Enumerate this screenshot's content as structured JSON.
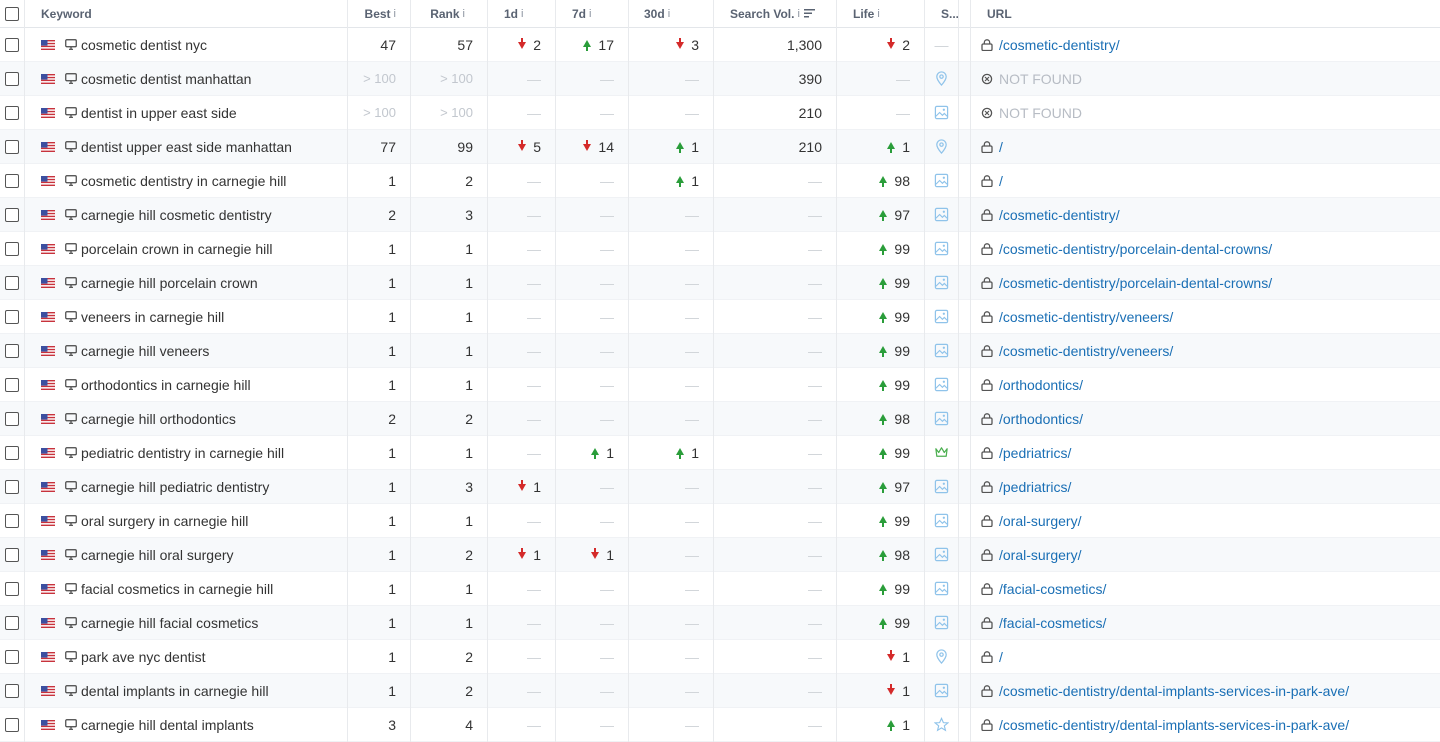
{
  "header": {
    "keyword": "Keyword",
    "best": "Best",
    "rank": "Rank",
    "d1": "1d",
    "d7": "7d",
    "d30": "30d",
    "search_vol": "Search Vol.",
    "life": "Life",
    "serp": "S...",
    "url": "URL",
    "info": "i"
  },
  "colors": {
    "up": "#2a9d3a",
    "down": "#d42a2a",
    "link": "#1a6fb5",
    "muted": "#c2c7ce"
  },
  "rows": [
    {
      "kw": "cosmetic dentist nyc",
      "best": "47",
      "rank": "57",
      "d1": {
        "dir": "down",
        "v": "2"
      },
      "d7": {
        "dir": "up",
        "v": "17"
      },
      "d30": {
        "dir": "down",
        "v": "3"
      },
      "vol": "1,300",
      "life": {
        "dir": "down",
        "v": "2"
      },
      "serp": "none",
      "url": "/cosmetic-dentistry/"
    },
    {
      "kw": "cosmetic dentist manhattan",
      "best": "> 100",
      "rank": "> 100",
      "d1": null,
      "d7": null,
      "d30": null,
      "vol": "390",
      "life": null,
      "serp": "pin-icon",
      "url": "NOT FOUND",
      "notfound": true
    },
    {
      "kw": "dentist in upper east side",
      "best": "> 100",
      "rank": "> 100",
      "d1": null,
      "d7": null,
      "d30": null,
      "vol": "210",
      "life": null,
      "serp": "image-icon",
      "url": "NOT FOUND",
      "notfound": true
    },
    {
      "kw": "dentist upper east side manhattan",
      "best": "77",
      "rank": "99",
      "d1": {
        "dir": "down",
        "v": "5"
      },
      "d7": {
        "dir": "down",
        "v": "14"
      },
      "d30": {
        "dir": "up",
        "v": "1"
      },
      "vol": "210",
      "life": {
        "dir": "up",
        "v": "1"
      },
      "serp": "pin-icon",
      "url": "/"
    },
    {
      "kw": "cosmetic dentistry in carnegie hill",
      "best": "1",
      "rank": "2",
      "d1": null,
      "d7": null,
      "d30": {
        "dir": "up",
        "v": "1"
      },
      "vol": null,
      "life": {
        "dir": "up",
        "v": "98"
      },
      "serp": "image-icon",
      "url": "/"
    },
    {
      "kw": "carnegie hill cosmetic dentistry",
      "best": "2",
      "rank": "3",
      "d1": null,
      "d7": null,
      "d30": null,
      "vol": null,
      "life": {
        "dir": "up",
        "v": "97"
      },
      "serp": "image-icon",
      "url": "/cosmetic-dentistry/"
    },
    {
      "kw": "porcelain crown in carnegie hill",
      "best": "1",
      "rank": "1",
      "d1": null,
      "d7": null,
      "d30": null,
      "vol": null,
      "life": {
        "dir": "up",
        "v": "99"
      },
      "serp": "image-icon",
      "url": "/cosmetic-dentistry/porcelain-dental-crowns/"
    },
    {
      "kw": "carnegie hill porcelain crown",
      "best": "1",
      "rank": "1",
      "d1": null,
      "d7": null,
      "d30": null,
      "vol": null,
      "life": {
        "dir": "up",
        "v": "99"
      },
      "serp": "image-icon",
      "url": "/cosmetic-dentistry/porcelain-dental-crowns/"
    },
    {
      "kw": "veneers in carnegie hill",
      "best": "1",
      "rank": "1",
      "d1": null,
      "d7": null,
      "d30": null,
      "vol": null,
      "life": {
        "dir": "up",
        "v": "99"
      },
      "serp": "image-icon",
      "url": "/cosmetic-dentistry/veneers/"
    },
    {
      "kw": "carnegie hill veneers",
      "best": "1",
      "rank": "1",
      "d1": null,
      "d7": null,
      "d30": null,
      "vol": null,
      "life": {
        "dir": "up",
        "v": "99"
      },
      "serp": "image-icon",
      "url": "/cosmetic-dentistry/veneers/"
    },
    {
      "kw": "orthodontics in carnegie hill",
      "best": "1",
      "rank": "1",
      "d1": null,
      "d7": null,
      "d30": null,
      "vol": null,
      "life": {
        "dir": "up",
        "v": "99"
      },
      "serp": "image-icon",
      "url": "/orthodontics/"
    },
    {
      "kw": "carnegie hill orthodontics",
      "best": "2",
      "rank": "2",
      "d1": null,
      "d7": null,
      "d30": null,
      "vol": null,
      "life": {
        "dir": "up",
        "v": "98"
      },
      "serp": "image-icon",
      "url": "/orthodontics/"
    },
    {
      "kw": "pediatric dentistry in carnegie hill",
      "best": "1",
      "rank": "1",
      "d1": null,
      "d7": {
        "dir": "up",
        "v": "1"
      },
      "d30": {
        "dir": "up",
        "v": "1"
      },
      "vol": null,
      "life": {
        "dir": "up",
        "v": "99"
      },
      "serp": "crown-icon",
      "url": "/pedriatrics/"
    },
    {
      "kw": "carnegie hill pediatric dentistry",
      "best": "1",
      "rank": "3",
      "d1": {
        "dir": "down",
        "v": "1"
      },
      "d7": null,
      "d30": null,
      "vol": null,
      "life": {
        "dir": "up",
        "v": "97"
      },
      "serp": "image-icon",
      "url": "/pedriatrics/"
    },
    {
      "kw": "oral surgery in carnegie hill",
      "best": "1",
      "rank": "1",
      "d1": null,
      "d7": null,
      "d30": null,
      "vol": null,
      "life": {
        "dir": "up",
        "v": "99"
      },
      "serp": "image-icon",
      "url": "/oral-surgery/"
    },
    {
      "kw": "carnegie hill oral surgery",
      "best": "1",
      "rank": "2",
      "d1": {
        "dir": "down",
        "v": "1"
      },
      "d7": {
        "dir": "down",
        "v": "1"
      },
      "d30": null,
      "vol": null,
      "life": {
        "dir": "up",
        "v": "98"
      },
      "serp": "image-icon",
      "url": "/oral-surgery/"
    },
    {
      "kw": "facial cosmetics in carnegie hill",
      "best": "1",
      "rank": "1",
      "d1": null,
      "d7": null,
      "d30": null,
      "vol": null,
      "life": {
        "dir": "up",
        "v": "99"
      },
      "serp": "image-icon",
      "url": "/facial-cosmetics/"
    },
    {
      "kw": "carnegie hill facial cosmetics",
      "best": "1",
      "rank": "1",
      "d1": null,
      "d7": null,
      "d30": null,
      "vol": null,
      "life": {
        "dir": "up",
        "v": "99"
      },
      "serp": "image-icon",
      "url": "/facial-cosmetics/"
    },
    {
      "kw": "park ave nyc dentist",
      "best": "1",
      "rank": "2",
      "d1": null,
      "d7": null,
      "d30": null,
      "vol": null,
      "life": {
        "dir": "down",
        "v": "1"
      },
      "serp": "pin-icon",
      "url": "/"
    },
    {
      "kw": "dental implants in carnegie hill",
      "best": "1",
      "rank": "2",
      "d1": null,
      "d7": null,
      "d30": null,
      "vol": null,
      "life": {
        "dir": "down",
        "v": "1"
      },
      "serp": "image-icon",
      "url": "/cosmetic-dentistry/dental-implants-services-in-park-ave/"
    },
    {
      "kw": "carnegie hill dental implants",
      "best": "3",
      "rank": "4",
      "d1": null,
      "d7": null,
      "d30": null,
      "vol": null,
      "life": {
        "dir": "up",
        "v": "1"
      },
      "serp": "star-icon",
      "url": "/cosmetic-dentistry/dental-implants-services-in-park-ave/"
    }
  ]
}
